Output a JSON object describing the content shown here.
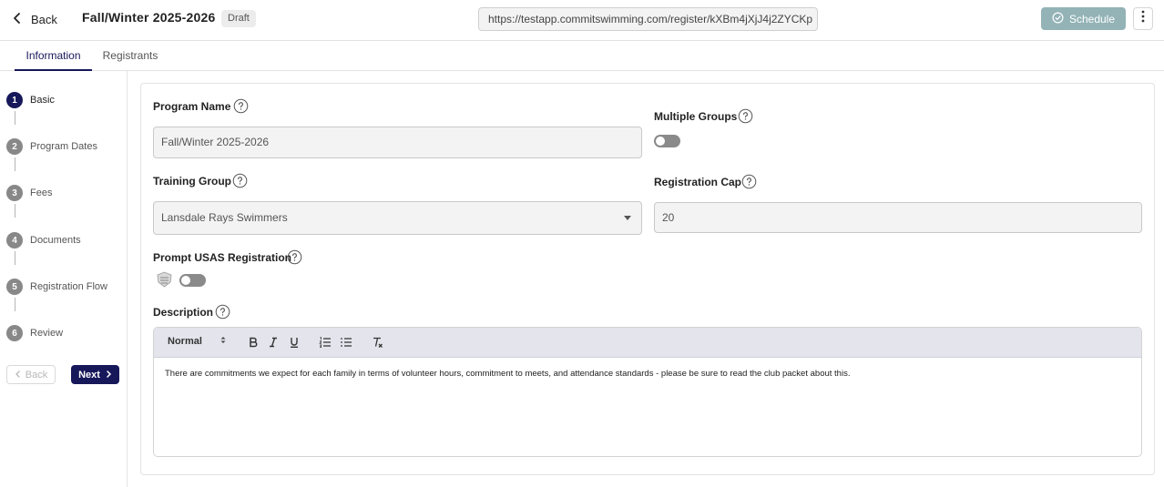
{
  "header": {
    "back_label": "Back",
    "title": "Fall/Winter 2025-2026",
    "status_badge": "Draft",
    "url": "https://testapp.commitswimming.com/register/kXBm4jXjJ4j2ZYCKp",
    "schedule_label": "Schedule"
  },
  "tabs": [
    {
      "label": "Information",
      "active": true
    },
    {
      "label": "Registrants",
      "active": false
    }
  ],
  "steps": [
    {
      "num": "1",
      "label": "Basic",
      "active": true
    },
    {
      "num": "2",
      "label": "Program Dates",
      "active": false
    },
    {
      "num": "3",
      "label": "Fees",
      "active": false
    },
    {
      "num": "4",
      "label": "Documents",
      "active": false
    },
    {
      "num": "5",
      "label": "Registration Flow",
      "active": false
    },
    {
      "num": "6",
      "label": "Review",
      "active": false
    }
  ],
  "step_nav": {
    "back_label": "Back",
    "next_label": "Next"
  },
  "form": {
    "program_name": {
      "label": "Program Name",
      "value": "Fall/Winter 2025-2026"
    },
    "multiple_groups": {
      "label": "Multiple Groups",
      "enabled": false
    },
    "training_group": {
      "label": "Training Group",
      "value": "Lansdale Rays Swimmers"
    },
    "registration_cap": {
      "label": "Registration Cap",
      "value": "20"
    },
    "prompt_usas": {
      "label": "Prompt USAS Registration",
      "enabled": false
    },
    "description": {
      "label": "Description",
      "format": "Normal",
      "text": "There are commitments we expect for each family in terms of volunteer hours, commitment to meets, and attendance standards - please be sure to read the club packet about this."
    }
  },
  "colors": {
    "primary": "#17185a",
    "schedule_button": "#93b3b6",
    "toolbar": "#e4e4ed"
  },
  "icons": [
    "chevron-left-icon",
    "check-circle-icon",
    "more-vertical-icon",
    "help-circle-icon",
    "dropdown-caret-icon",
    "usas-logo-icon",
    "bold-icon",
    "italic-icon",
    "underline-icon",
    "ordered-list-icon",
    "bullet-list-icon",
    "clear-format-icon",
    "chevron-right-icon"
  ]
}
